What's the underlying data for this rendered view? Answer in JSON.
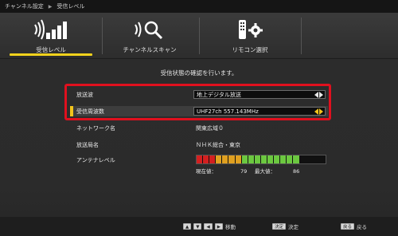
{
  "breadcrumb": {
    "parent": "チャンネル設定",
    "current": "受信レベル"
  },
  "tabs": [
    {
      "label": "受信レベル",
      "icon": "signal-bars-icon",
      "active": true
    },
    {
      "label": "チャンネルスキャン",
      "icon": "search-icon",
      "active": false
    },
    {
      "label": "リモコン選択",
      "icon": "remote-gear-icon",
      "active": false
    }
  ],
  "hint": "受信状態の確認を行います。",
  "settings": {
    "broadcast_label": "放送波",
    "broadcast_value": "地上デジタル放送",
    "frequency_label": "受信周波数",
    "frequency_value": "UHF27ch 557.143MHz",
    "network_label": "ネットワーク名",
    "network_value": "関東広域０",
    "station_label": "放送局名",
    "station_value": "ＮＨＫ総合・東京",
    "antenna_label": "アンテナレベル"
  },
  "antenna": {
    "current_label": "現在値：",
    "current_value": "79",
    "max_label": "最大値：",
    "max_value": "86",
    "level_fraction": 0.79
  },
  "footer": {
    "move_label": "移動",
    "ok_key": "決定",
    "ok_label": "決定",
    "back_key": "戻る",
    "back_label": "戻る"
  },
  "colors": {
    "accent": "#f2d21c",
    "highlight_border": "#e0101e"
  }
}
